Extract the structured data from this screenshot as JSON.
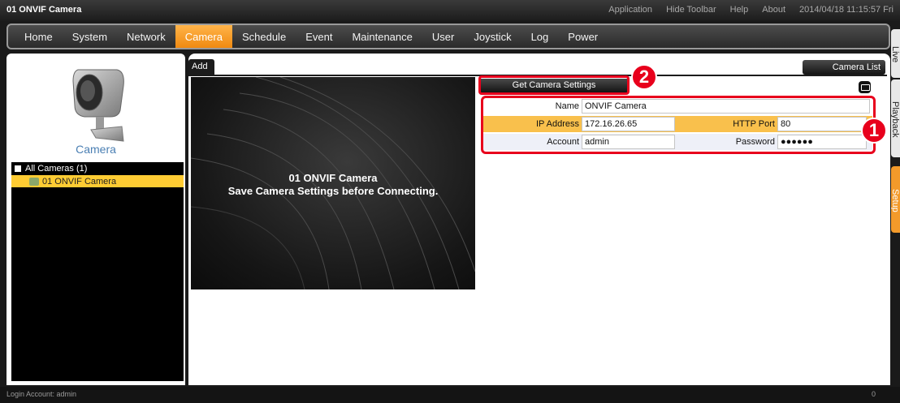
{
  "window": {
    "title": "01 ONVIF Camera",
    "links": [
      "Application",
      "Hide Toolbar",
      "Help",
      "About"
    ],
    "datetime": "2014/04/18 11:15:57 Fri"
  },
  "menu": {
    "items": [
      "Home",
      "System",
      "Network",
      "Camera",
      "Schedule",
      "Event",
      "Maintenance",
      "User",
      "Joystick",
      "Log",
      "Power"
    ],
    "active": "Camera",
    "accent_color": "#f39a2a"
  },
  "side_tabs": [
    "Live",
    "Playback",
    "Setup"
  ],
  "left_panel": {
    "icon": "camera-icon",
    "label": "Camera",
    "tree": {
      "root_label": "All Cameras (1)",
      "items": [
        "01  ONVIF Camera"
      ]
    }
  },
  "main": {
    "tab": "Add",
    "camera_list_button": "Camera List",
    "preview": {
      "title": "01 ONVIF Camera",
      "message": "Save Camera Settings before Connecting."
    },
    "get_settings_button": "Get Camera Settings",
    "form": {
      "name_label": "Name",
      "name_value": "ONVIF Camera",
      "ip_label": "IP Address",
      "ip_value": "172.16.26.65",
      "http_port_label": "HTTP Port",
      "http_port_value": "80",
      "account_label": "Account",
      "account_value": "admin",
      "password_label": "Password",
      "password_value": "●●●●●●"
    }
  },
  "annotations": {
    "badge1": "1",
    "badge2": "2",
    "color": "#e8001c"
  },
  "status_bar": {
    "login": "Login Account: admin",
    "count": "0"
  }
}
